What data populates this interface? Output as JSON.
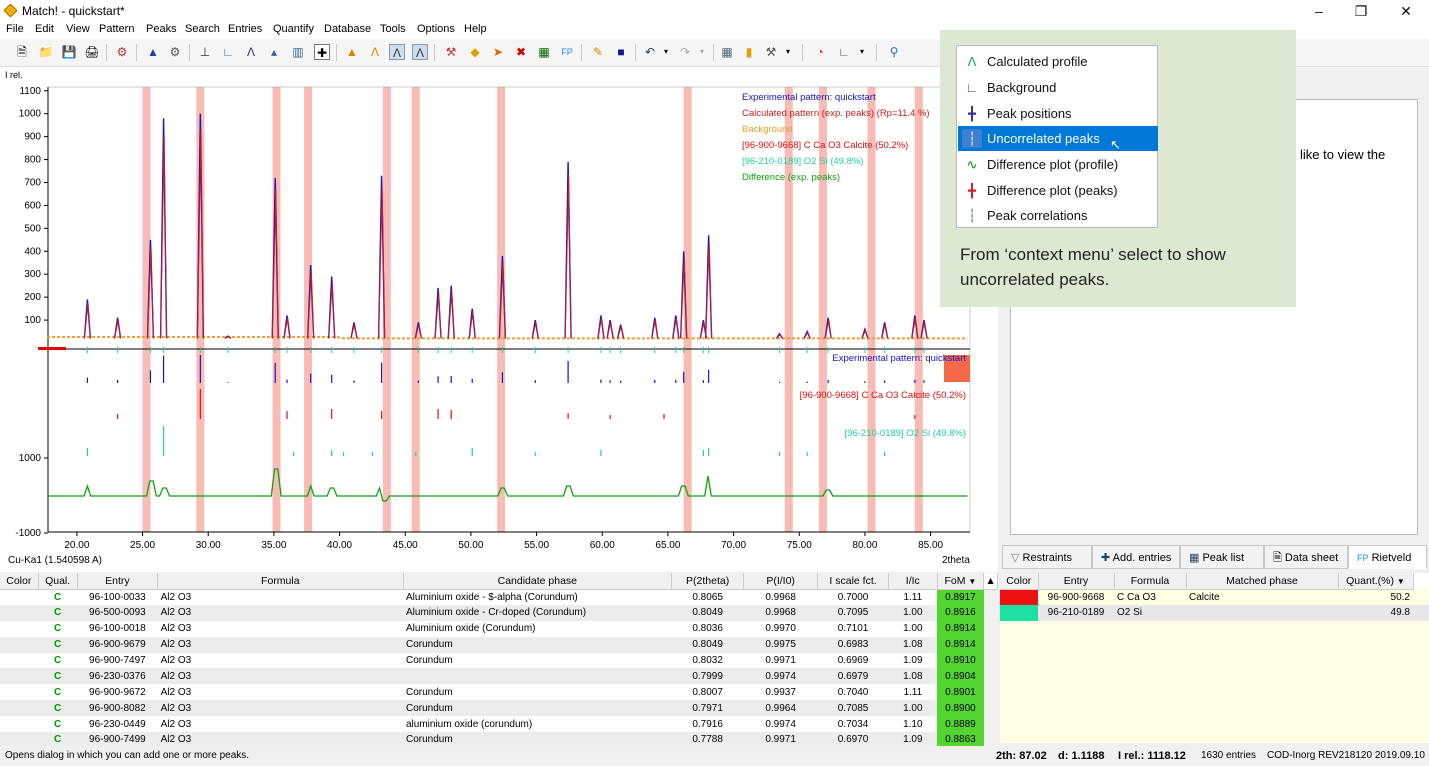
{
  "window": {
    "title": "Match! - quickstart*"
  },
  "menu": [
    "File",
    "Edit",
    "View",
    "Pattern",
    "Peaks",
    "Search",
    "Entries",
    "Quantify",
    "Database",
    "Tools",
    "Options",
    "Help"
  ],
  "plot": {
    "y_axis_label": "I rel.",
    "y_ticks": [
      "1100",
      "1000",
      "900",
      "800",
      "700",
      "600",
      "500",
      "400",
      "300",
      "200",
      "100"
    ],
    "y_ticks_lower": [
      "1000",
      "-1000"
    ],
    "x_ticks": [
      "20.00",
      "25.00",
      "30.00",
      "35.00",
      "40.00",
      "45.00",
      "50.00",
      "55.00",
      "60.00",
      "65.00",
      "70.00",
      "75.00",
      "80.00",
      "85.00"
    ],
    "x_label": "2theta",
    "radiation": "Cu-Ka1 (1.540598 A)",
    "legend": [
      {
        "text": "Experimental pattern: quickstart",
        "color": "#1515c8"
      },
      {
        "text": "Calculated pattern (exp. peaks) (Rp=11.4 %)",
        "color": "#c81e1e"
      },
      {
        "text": "Background",
        "color": "#f39c2c"
      },
      {
        "text": "[96-900-9668] C Ca O3  Calcite (50.2%)",
        "color": "#e01010"
      },
      {
        "text": "[96-210-0189] O2 Si  (49.8%)",
        "color": "#20d0a0"
      },
      {
        "text": "Difference (exp. peaks)",
        "color": "#10a010"
      }
    ],
    "strip_labels": [
      {
        "text": "Experimental pattern: quickstart",
        "color": "#1515c8"
      },
      {
        "text": "[96-900-9668] C Ca O3  Calcite (50.2%)",
        "color": "#e01010"
      },
      {
        "text": "[96-210-0189] O2 Si  (49.8%)",
        "color": "#20d0a0"
      }
    ]
  },
  "context_menu": {
    "items": [
      {
        "label": "Calculated profile",
        "icon": "calculated-profile-icon"
      },
      {
        "label": "Background",
        "icon": "background-icon"
      },
      {
        "label": "Peak positions",
        "icon": "peak-positions-icon"
      },
      {
        "label": "Uncorrelated peaks",
        "icon": "uncorrelated-peaks-icon",
        "selected": true
      },
      {
        "label": "Difference plot (profile)",
        "icon": "difference-profile-icon"
      },
      {
        "label": "Difference plot (peaks)",
        "icon": "difference-peaks-icon"
      },
      {
        "label": "Peak correlations",
        "icon": "peak-correlations-icon"
      }
    ]
  },
  "callout_text": "From ‘context menu’ select to show uncorrelated peaks.",
  "right_panel_text": "like to view the",
  "right_tabs": [
    "Restraints",
    "Add. entries",
    "Peak list",
    "Data sheet",
    "Rietveld"
  ],
  "candidates": {
    "headers": [
      "Color",
      "Qual.",
      "Entry",
      "Formula",
      "Candidate phase",
      "P(2theta)",
      "P(I/I0)",
      "I scale fct.",
      "I/Ic",
      "FoM"
    ],
    "rows": [
      [
        "",
        "C",
        "96-100-0033",
        "Al2 O3",
        "Aluminium oxide - $-alpha (Corundum)",
        "0.8065",
        "0.9968",
        "0.7000",
        "1.11",
        "0.8917"
      ],
      [
        "",
        "C",
        "96-500-0093",
        "Al2 O3",
        "Aluminium oxide - Cr-doped (Corundum)",
        "0.8049",
        "0.9968",
        "0.7095",
        "1.00",
        "0.8916"
      ],
      [
        "",
        "C",
        "96-100-0018",
        "Al2 O3",
        "Aluminium oxide (Corundum)",
        "0.8036",
        "0.9970",
        "0.7101",
        "1.00",
        "0.8914"
      ],
      [
        "",
        "C",
        "96-900-9679",
        "Al2 O3",
        "Corundum",
        "0.8049",
        "0.9975",
        "0.6983",
        "1.08",
        "0.8914"
      ],
      [
        "",
        "C",
        "96-900-7497",
        "Al2 O3",
        "Corundum",
        "0.8032",
        "0.9971",
        "0.6969",
        "1.09",
        "0.8910"
      ],
      [
        "",
        "C",
        "96-230-0376",
        "Al2 O3",
        "",
        "0.7999",
        "0.9974",
        "0.6979",
        "1.08",
        "0.8904"
      ],
      [
        "",
        "C",
        "96-900-9672",
        "Al2 O3",
        "Corundum",
        "0.8007",
        "0.9937",
        "0.7040",
        "1.11",
        "0.8901"
      ],
      [
        "",
        "C",
        "96-900-8082",
        "Al2 O3",
        "Corundum",
        "0.7971",
        "0.9964",
        "0.7085",
        "1.00",
        "0.8900"
      ],
      [
        "",
        "C",
        "96-230-0449",
        "Al2 O3",
        "aluminium oxide (corundum)",
        "0.7916",
        "0.9974",
        "0.7034",
        "1.10",
        "0.8889"
      ],
      [
        "",
        "C",
        "96-900-7499",
        "Al2 O3",
        "Corundum",
        "0.7788",
        "0.9971",
        "0.6970",
        "1.09",
        "0.8863"
      ]
    ]
  },
  "matched": {
    "headers": [
      "Color",
      "Entry",
      "Formula",
      "Matched phase",
      "Quant.(%)"
    ],
    "rows": [
      {
        "color": "#ee1111",
        "entry": "96-900-9668",
        "formula": "C Ca O3",
        "phase": "Calcite",
        "quant": "50.2"
      },
      {
        "color": "#1ee0a0",
        "entry": "96-210-0189",
        "formula": "O2 Si",
        "phase": "",
        "quant": "49.8"
      }
    ]
  },
  "status": {
    "message": "Opens dialog in which you can add one or more peaks.",
    "twotheta": "2th: 87.02",
    "d": "d: 1.1188",
    "irel": "I rel.: 1118.12",
    "entries": "1630 entries",
    "db": "COD-Inorg REV218120 2019.09.10"
  }
}
